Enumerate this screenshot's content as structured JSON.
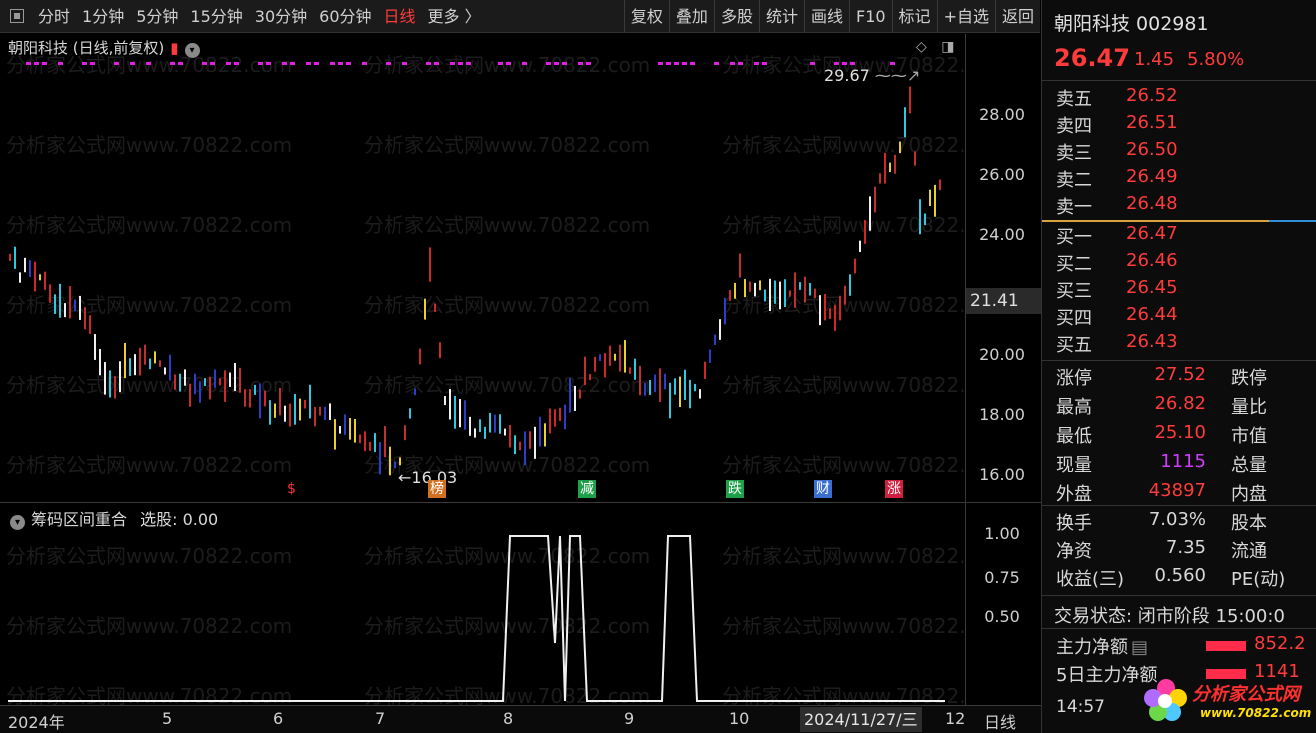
{
  "toolbar": {
    "left": [
      "分时",
      "1分钟",
      "5分钟",
      "15分钟",
      "30分钟",
      "60分钟",
      "日线",
      "更多 〉"
    ],
    "active": "日线",
    "right": [
      "复权",
      "叠加",
      "多股",
      "统计",
      "画线",
      "F10",
      "标记",
      "+自选",
      "返回"
    ]
  },
  "chart": {
    "title": "朝阳科技 (日线,前复权)",
    "y_ticks": [
      "28.00",
      "26.00",
      "24.00",
      "20.00",
      "18.00",
      "16.00"
    ],
    "current_price_label": "21.41",
    "high_label": "29.67",
    "low_label": "16.03",
    "event_markers": [
      "$",
      "榜",
      "减",
      "跌",
      "财",
      "涨"
    ],
    "watermark": "分析家公式网www.70822.com"
  },
  "indicator": {
    "title": "筹码区间重合",
    "select_label": "选股: 0.00",
    "y_ticks": [
      "1.00",
      "0.75",
      "0.50"
    ]
  },
  "date_axis": {
    "ticks": [
      "2024年",
      "5",
      "6",
      "7",
      "8",
      "9",
      "10",
      "12"
    ],
    "cursor": "2024/11/27/三",
    "mode": "日线"
  },
  "quote": {
    "name": "朝阳科技 002981",
    "price": "26.47",
    "change": "1.45",
    "change_pct": "5.80%",
    "asks": [
      {
        "label": "卖五",
        "price": "26.52"
      },
      {
        "label": "卖四",
        "price": "26.51"
      },
      {
        "label": "卖三",
        "price": "26.50"
      },
      {
        "label": "卖二",
        "price": "26.49"
      },
      {
        "label": "卖一",
        "price": "26.48"
      }
    ],
    "bids": [
      {
        "label": "买一",
        "price": "26.47"
      },
      {
        "label": "买二",
        "price": "26.46"
      },
      {
        "label": "买三",
        "price": "26.45"
      },
      {
        "label": "买四",
        "price": "26.44"
      },
      {
        "label": "买五",
        "price": "26.43"
      }
    ],
    "stats": [
      {
        "l1": "涨停",
        "v1": "27.52",
        "c1": "#ff3b3b",
        "l2": "跌停"
      },
      {
        "l1": "最高",
        "v1": "26.82",
        "c1": "#ff3b3b",
        "l2": "量比"
      },
      {
        "l1": "最低",
        "v1": "25.10",
        "c1": "#ff3b3b",
        "l2": "市值"
      },
      {
        "l1": "现量",
        "v1": "1115",
        "c1": "#d23cff",
        "l2": "总量"
      },
      {
        "l1": "外盘",
        "v1": "43897",
        "c1": "#ff3b3b",
        "l2": "内盘"
      }
    ],
    "stats2": [
      {
        "l1": "换手",
        "v1": "7.03%",
        "c1": "#d8d8d8",
        "l2": "股本"
      },
      {
        "l1": "净资",
        "v1": "7.35",
        "c1": "#d8d8d8",
        "l2": "流通"
      },
      {
        "l1": "收益(三)",
        "v1": "0.560",
        "c1": "#d8d8d8",
        "l2": "PE(动)"
      }
    ],
    "trade_state": "交易状态: 闭市阶段 15:00:0",
    "flows": [
      {
        "label": "主力净额",
        "value": "852.2"
      },
      {
        "label": "5日主力净额",
        "value": "1141"
      }
    ],
    "time": "14:57",
    "logo_text": "分析家公式网",
    "logo_url": "www.70822.com"
  }
}
